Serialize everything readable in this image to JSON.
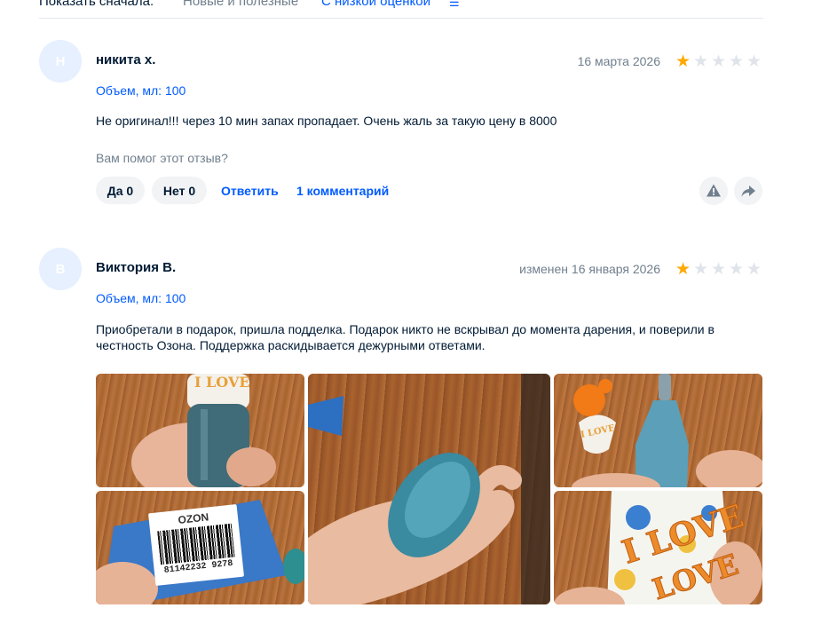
{
  "sort": {
    "label": "Показать сначала:",
    "option_new": "Новые и полезные",
    "option_low": "С низкой оценкой",
    "icon": "sort-lines-icon"
  },
  "reviews": [
    {
      "avatar_letter": "Н",
      "author": "никита х.",
      "date": "16 марта 2026",
      "rating": 1,
      "volume": "Объем, мл: 100",
      "text": "Не оригинал!!! через 10 мин запах пропадает. Очень жаль за такую цену в 8000",
      "helpful_prompt": "Вам помог этот отзыв?",
      "yes_label": "Да 0",
      "no_label": "Нет 0",
      "reply_label": "Ответить",
      "comments_label": "1 комментарий"
    },
    {
      "avatar_letter": "В",
      "author": "Виктория В.",
      "date": "изменен 16 января 2026",
      "rating": 1,
      "volume": "Объем, мл: 100",
      "text": "Приобретали в подарок, пришла подделка. Подарок никто не вскрывал до момента дарения, и поверили в честность Озона. Поддержка раскидывается дежурными ответами.",
      "photos": [
        {
          "name": "photo-bottle-top-love",
          "label": "I LOVE"
        },
        {
          "name": "photo-box-barcode",
          "brand": "OZON",
          "barcode_number": "81142232 9278"
        },
        {
          "name": "photo-bottle-cap-in-hand"
        },
        {
          "name": "photo-bottle-and-cap",
          "label": "I LOVE"
        },
        {
          "name": "photo-box-i-love",
          "label_1": "I LOVE",
          "label_2": "LOVE"
        }
      ]
    }
  ],
  "colors": {
    "accent": "#005bff",
    "star_active": "#ffa800",
    "star_inactive": "#e0e4ea",
    "text": "#001a34",
    "muted": "#707f8d"
  }
}
